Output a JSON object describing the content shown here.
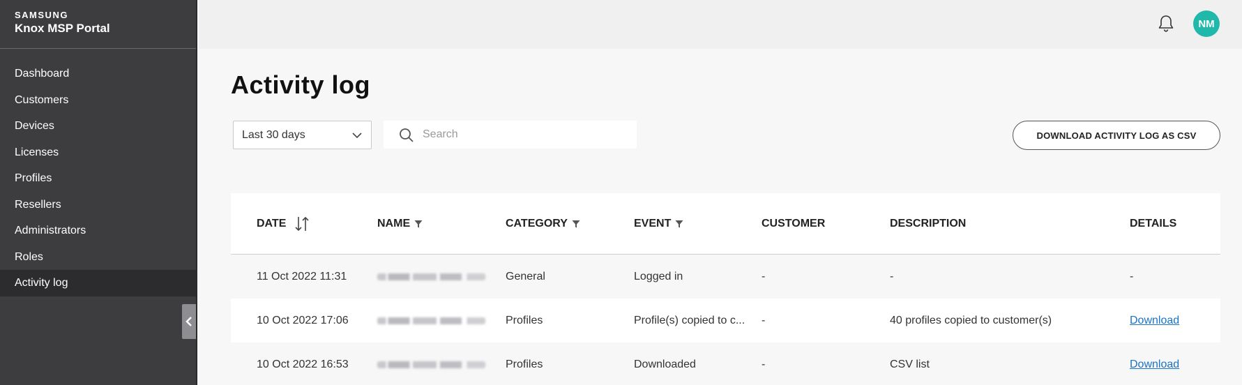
{
  "brand": {
    "top": "SAMSUNG",
    "sub": "Knox MSP Portal"
  },
  "nav": {
    "items": [
      {
        "label": "Dashboard",
        "active": false
      },
      {
        "label": "Customers",
        "active": false
      },
      {
        "label": "Devices",
        "active": false
      },
      {
        "label": "Licenses",
        "active": false
      },
      {
        "label": "Profiles",
        "active": false
      },
      {
        "label": "Resellers",
        "active": false
      },
      {
        "label": "Administrators",
        "active": false
      },
      {
        "label": "Roles",
        "active": false
      },
      {
        "label": "Activity log",
        "active": true
      }
    ]
  },
  "header": {
    "avatar_initials": "NM",
    "bell_icon": "bell-icon",
    "avatar_color": "#1fb8aa"
  },
  "page": {
    "title": "Activity log"
  },
  "filters": {
    "range_value": "Last 30 days",
    "search_placeholder": "Search",
    "download_csv_label": "DOWNLOAD ACTIVITY LOG AS CSV"
  },
  "table": {
    "headers": {
      "date": "DATE",
      "name": "NAME",
      "category": "CATEGORY",
      "event": "EVENT",
      "customer": "CUSTOMER",
      "description": "DESCRIPTION",
      "details": "DETAILS"
    },
    "rows": [
      {
        "date": "11 Oct 2022 11:31",
        "category": "General",
        "event": "Logged in",
        "customer": "-",
        "description": "-",
        "details": "-"
      },
      {
        "date": "10 Oct 2022 17:06",
        "category": "Profiles",
        "event": "Profile(s) copied to c...",
        "customer": "-",
        "description": "40 profiles copied to customer(s)",
        "details": "Download"
      },
      {
        "date": "10 Oct 2022 16:53",
        "category": "Profiles",
        "event": "Downloaded",
        "customer": "-",
        "description": "CSV list",
        "details": "Download"
      }
    ]
  }
}
